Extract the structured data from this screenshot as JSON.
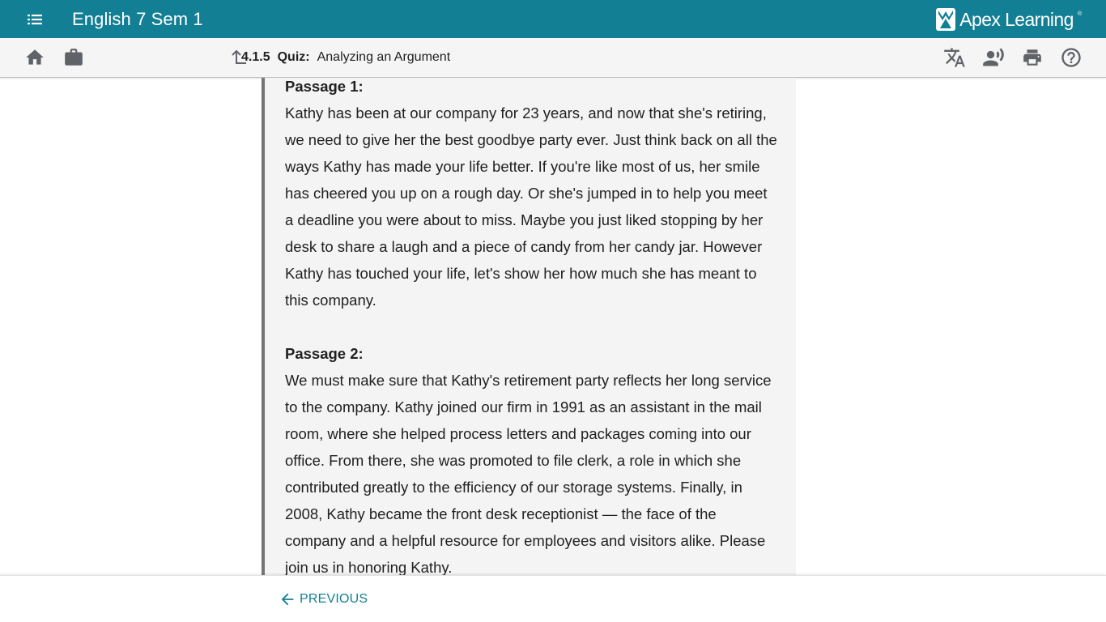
{
  "appbar": {
    "course_title": "English 7 Sem 1",
    "brand_name": "Apex Learning",
    "brand_mark": "®",
    "icons": [
      "menu-icon",
      "apex-logo-icon"
    ]
  },
  "toolbar": {
    "activity_number": "4.1.5",
    "activity_type": "Quiz:",
    "activity_name": "Analyzing an Argument",
    "icons": [
      "home-icon",
      "briefcase-icon",
      "up-arrow-icon",
      "translate-icon",
      "text-to-speech-icon",
      "print-icon",
      "help-icon"
    ]
  },
  "passages": [
    {
      "heading": "Passage 1:",
      "text": "Kathy has been at our company for 23 years, and now that she's retiring, we need to give her the best goodbye party ever. Just think back on all the ways Kathy has made your life better. If you're like most of us, her smile has cheered you up on a rough day. Or she's jumped in to help you meet a deadline you were about to miss. Maybe you just liked stopping by her desk to share a laugh and a piece of candy from her candy jar. However Kathy has touched your life, let's show her how much she has meant to this company."
    },
    {
      "heading": "Passage 2:",
      "text": "We must make sure that Kathy's retirement party reflects her long service to the company. Kathy joined our firm in 1991 as an assistant in the mail room, where she helped process letters and packages coming into our office. From there, she was promoted to file clerk, a role in which she contributed greatly to the efficiency of our storage systems. Finally, in 2008, Kathy became the front desk receptionist — the face of the company and a helpful resource for employees and visitors alike. Please join us in honoring Kathy."
    }
  ],
  "footer": {
    "previous_label": "PREVIOUS",
    "icons": [
      "arrow-left-icon"
    ]
  },
  "colors": {
    "brand_teal": "#137f94",
    "toolbar_bg": "#f5f5f5",
    "panel_bg": "#f4f4f4",
    "icon_gray": "#5f6368"
  }
}
